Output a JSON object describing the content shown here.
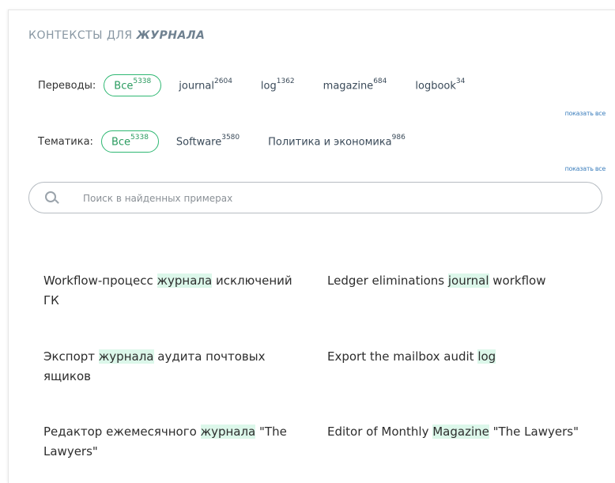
{
  "title": {
    "prefix": "КОНТЕКСТЫ ДЛЯ ",
    "word": "ЖУРНАЛА"
  },
  "translations": {
    "label": "Переводы:",
    "all": {
      "label": "Все",
      "count": "5338"
    },
    "items": [
      {
        "label": "journal",
        "count": "2604"
      },
      {
        "label": "log",
        "count": "1362"
      },
      {
        "label": "magazine",
        "count": "684"
      },
      {
        "label": "logbook",
        "count": "34"
      }
    ],
    "show_all": "показать все"
  },
  "topics": {
    "label": "Тематика:",
    "all": {
      "label": "Все",
      "count": "5338"
    },
    "items": [
      {
        "label": "Software",
        "count": "3580"
      },
      {
        "label": "Политика и экономика",
        "count": "986"
      }
    ],
    "show_all": "показать все"
  },
  "search": {
    "placeholder": "Поиск в найденных примерах",
    "icon": "search-icon"
  },
  "examples": [
    {
      "ru": {
        "before": "Workflow-процесс ",
        "hl": "журнала",
        "after": " исключений ГК"
      },
      "en": {
        "before": "Ledger eliminations ",
        "hl": "journal",
        "after": " workflow"
      }
    },
    {
      "ru": {
        "before": "Экспорт ",
        "hl": "журнала",
        "after": " аудита почтовых ящиков"
      },
      "en": {
        "before": "Export the mailbox audit ",
        "hl": "log",
        "after": ""
      }
    },
    {
      "ru": {
        "before": "Редактор ежемесячного ",
        "hl": "журнала",
        "after": " \"The Lawyers\""
      },
      "en": {
        "before": "Editor of Monthly ",
        "hl": "Magazine",
        "after": " \"The Lawyers\""
      }
    }
  ],
  "colors": {
    "accent": "#2fb873",
    "highlight": "#dcf7ea",
    "link": "#3d7fbd"
  }
}
